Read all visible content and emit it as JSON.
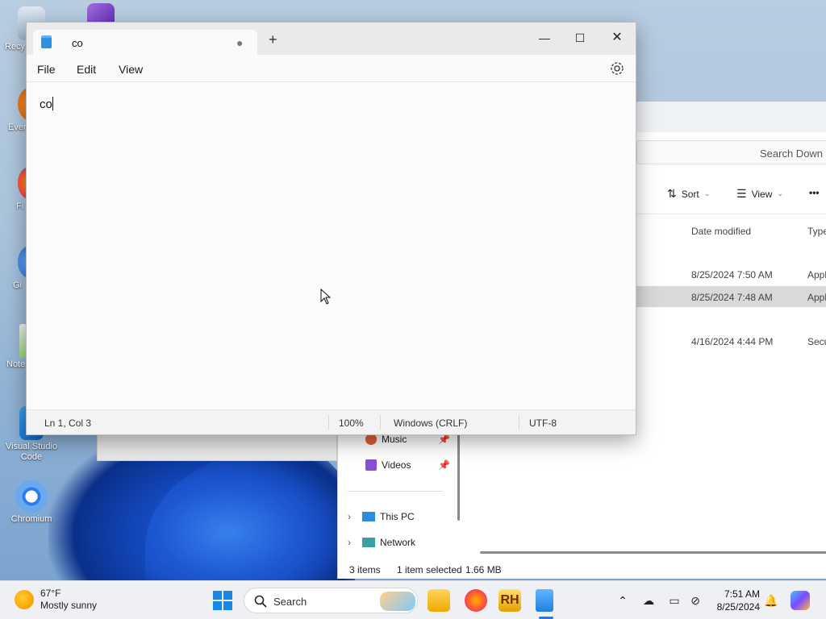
{
  "desktop": {
    "icons": [
      {
        "label": "Recy"
      },
      {
        "label": "Ever"
      },
      {
        "label": "Fi"
      },
      {
        "label": "Gi"
      },
      {
        "label": "Note"
      },
      {
        "label": "Visual Studio Code"
      },
      {
        "label": "Chromium"
      }
    ]
  },
  "explorer": {
    "search_placeholder": "Search Down",
    "sort_label": "Sort",
    "view_label": "View",
    "more_label": "•••",
    "column_date": "Date modified",
    "column_type": "Type",
    "rows": [
      {
        "date": "8/25/2024 7:50 AM",
        "type": "Appl",
        "selected": false
      },
      {
        "date": "8/25/2024 7:48 AM",
        "type": "Appl",
        "selected": true
      },
      {
        "date": "4/16/2024 4:44 PM",
        "type": "Secu",
        "selected": false
      }
    ],
    "nav": {
      "music": "Music",
      "videos": "Videos",
      "this_pc": "This PC",
      "network": "Network"
    },
    "status": {
      "items": "3 items",
      "selected": "1 item selected",
      "size": "1.66 MB"
    }
  },
  "notepad": {
    "tab_title": "co",
    "menu": {
      "file": "File",
      "edit": "Edit",
      "view": "View"
    },
    "content": "co",
    "status": {
      "position": "Ln 1, Col 3",
      "zoom": "100%",
      "line_endings": "Windows (CRLF)",
      "encoding": "UTF-8"
    }
  },
  "taskbar": {
    "weather_temp": "67°F",
    "weather_desc": "Mostly sunny",
    "search_label": "Search",
    "time": "7:51 AM",
    "date": "8/25/2024"
  }
}
